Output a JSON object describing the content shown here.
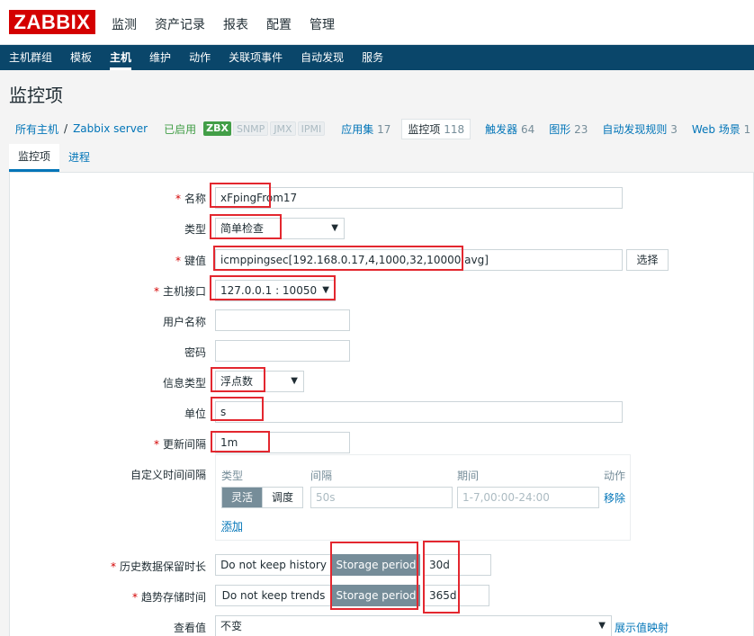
{
  "header": {
    "logo": "ZABBIX",
    "menu": [
      "监测",
      "资产记录",
      "报表",
      "配置",
      "管理"
    ]
  },
  "subnav": {
    "items": [
      "主机群组",
      "模板",
      "主机",
      "维护",
      "动作",
      "关联项事件",
      "自动发现",
      "服务"
    ]
  },
  "page": {
    "title": "监控项"
  },
  "hostnav": {
    "all_hosts": "所有主机",
    "separator": "/",
    "host": "Zabbix server",
    "status": "已启用",
    "badges": [
      "ZBX",
      "SNMP",
      "JMX",
      "IPMI"
    ],
    "applications": {
      "label": "应用集",
      "count": "17"
    },
    "items": {
      "label": "监控项",
      "count": "118"
    },
    "triggers": {
      "label": "触发器",
      "count": "64"
    },
    "graphs": {
      "label": "图形",
      "count": "23"
    },
    "discovery": {
      "label": "自动发现规则",
      "count": "3"
    },
    "web": {
      "label": "Web 场景",
      "count": "1"
    }
  },
  "tabs": [
    "监控项",
    "进程"
  ],
  "form": {
    "name": {
      "label": "名称",
      "value": "xFpingFrom17"
    },
    "type": {
      "label": "类型",
      "value": "简单检查"
    },
    "key": {
      "label": "键值",
      "value": "icmppingsec[192.168.0.17,4,1000,32,10000,avg]",
      "button": "选择"
    },
    "interface": {
      "label": "主机接口",
      "value": "127.0.0.1 : 10050"
    },
    "username": {
      "label": "用户名称",
      "value": ""
    },
    "password": {
      "label": "密码",
      "value": ""
    },
    "info_type": {
      "label": "信息类型",
      "value": "浮点数"
    },
    "units": {
      "label": "单位",
      "value": "s"
    },
    "interval": {
      "label": "更新间隔",
      "value": "1m"
    },
    "custom_intervals": {
      "label": "自定义时间间隔",
      "headers": {
        "type": "类型",
        "interval": "间隔",
        "period": "期间",
        "action": "动作"
      },
      "seg_flexible": "灵活",
      "seg_scheduling": "调度",
      "interval_placeholder": "50s",
      "period_placeholder": "1-7,00:00-24:00",
      "remove": "移除",
      "add": "添加"
    },
    "history": {
      "label": "历史数据保留时长",
      "no_keep": "Do not keep history",
      "storage": "Storage period",
      "value": "30d"
    },
    "trends": {
      "label": "趋势存储时间",
      "no_keep": "Do not keep trends",
      "storage": "Storage period",
      "value": "365d"
    },
    "valuemap": {
      "label": "查看值",
      "value": "不变",
      "link": "展示值映射"
    }
  },
  "colors": {
    "logo_red": "#d40000",
    "nav_blue": "#0a466a",
    "link_blue": "#0275b8",
    "enabled_green": "#429e47",
    "annotation_red": "#e3272f"
  }
}
